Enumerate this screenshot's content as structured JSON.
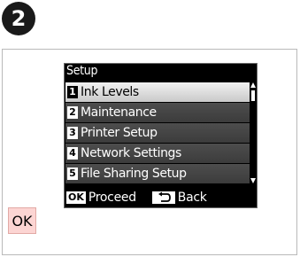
{
  "step": {
    "number": "2"
  },
  "lcd": {
    "title": "Setup",
    "items": [
      {
        "num": "1",
        "label": "Ink Levels",
        "selected": true
      },
      {
        "num": "2",
        "label": "Maintenance",
        "selected": false
      },
      {
        "num": "3",
        "label": "Printer Setup",
        "selected": false
      },
      {
        "num": "4",
        "label": "Network Settings",
        "selected": false
      },
      {
        "num": "5",
        "label": "File Sharing Setup",
        "selected": false
      }
    ],
    "footer": {
      "ok_key": "OK",
      "proceed_label": "Proceed",
      "back_key_icon": "back-arrow-icon",
      "back_label": "Back"
    }
  },
  "ok_button": {
    "label": "OK"
  },
  "colors": {
    "lcd_background": "#000000",
    "selected_row": "#e0e0e0",
    "ok_button_fill": "#fcd5d3"
  }
}
